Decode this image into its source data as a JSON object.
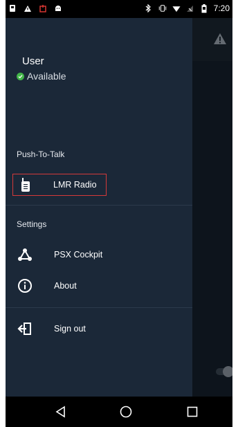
{
  "status_bar": {
    "time": "7:20",
    "icons_left": [
      "notification-icon",
      "alert-icon",
      "alarm-icon",
      "android-icon"
    ],
    "icons_right": [
      "bluetooth-icon",
      "vibrate-icon",
      "wifi-icon",
      "signal-icon",
      "battery-icon"
    ]
  },
  "drawer": {
    "user": {
      "name": "User",
      "status": "Available"
    },
    "sections": {
      "ptt_header": "Push-To-Talk",
      "settings_header": "Settings"
    },
    "items": {
      "lmr_radio": "LMR Radio",
      "psx_cockpit": "PSX Cockpit",
      "about": "About",
      "sign_out": "Sign out"
    }
  },
  "colors": {
    "drawer_bg": "#1b2838",
    "selection_border": "#d63a3a",
    "available_green": "#43b649"
  }
}
